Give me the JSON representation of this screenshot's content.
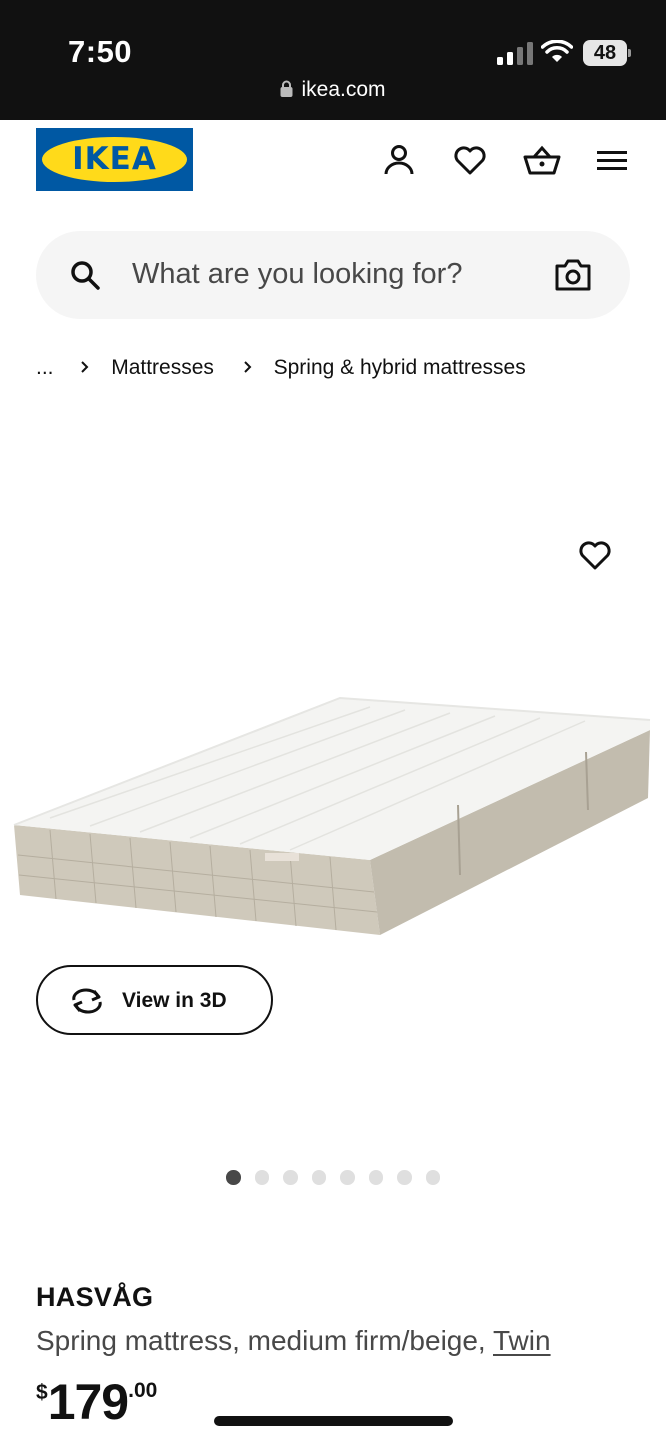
{
  "status_bar": {
    "time": "7:50",
    "battery": "48",
    "url": "ikea.com",
    "icons": [
      "signal-icon",
      "wifi-icon",
      "battery-icon",
      "lock-icon"
    ]
  },
  "header": {
    "logo_text": "IKEA",
    "icons": [
      "profile-icon",
      "heart-icon",
      "shopping-bag-icon",
      "menu-icon"
    ]
  },
  "search": {
    "placeholder": "What are you looking for?",
    "icons": [
      "search-icon",
      "camera-icon"
    ]
  },
  "breadcrumb": {
    "items": [
      "...",
      "Mattresses",
      "Spring & hybrid mattresses"
    ]
  },
  "gallery": {
    "view_3d_label": "View in 3D",
    "image_count": 8,
    "active_index": 0
  },
  "product": {
    "name": "HASVÅG",
    "description": "Spring mattress, medium firm/beige,",
    "size": "Twin",
    "price_currency": "$",
    "price_int": "179",
    "price_dec": ".00"
  },
  "colors": {
    "ikea_blue": "#0058a3",
    "ikea_yellow": "#ffda1a",
    "text": "#111111",
    "muted": "#484848"
  }
}
